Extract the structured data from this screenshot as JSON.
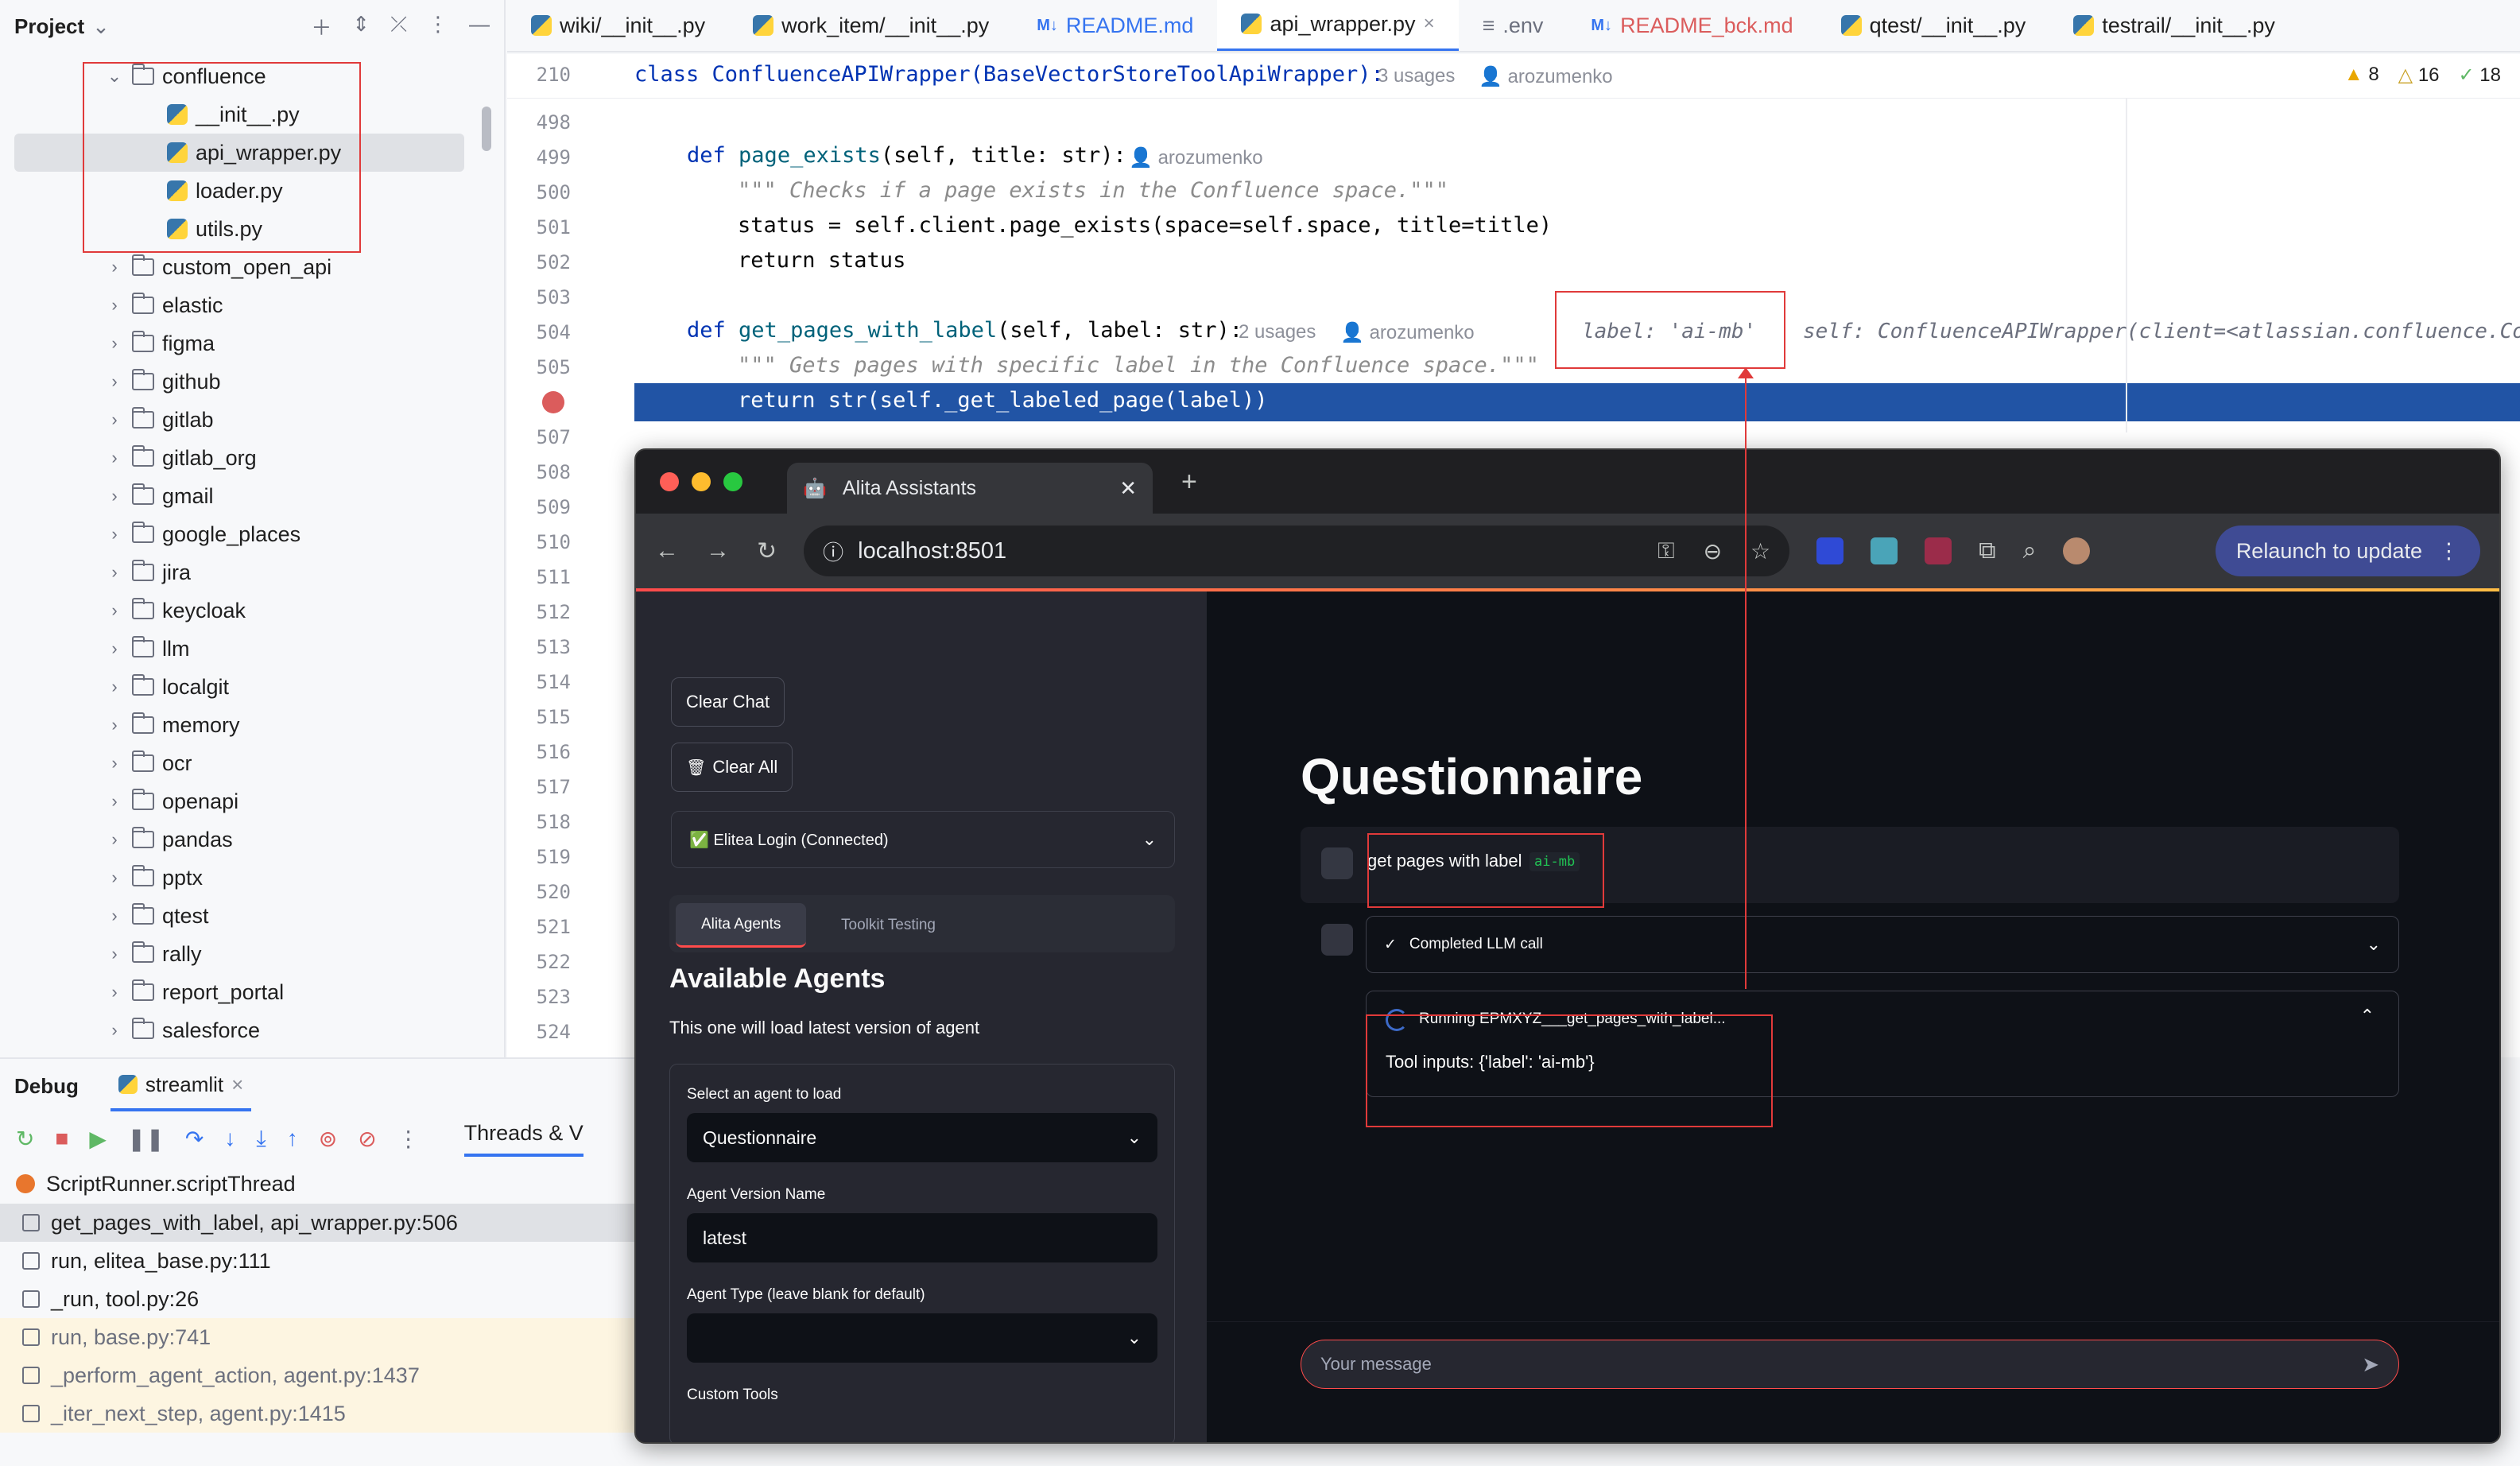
{
  "project": {
    "title": "Project",
    "items": [
      {
        "label": "confluence",
        "kind": "folder",
        "expanded": true
      },
      {
        "label": "__init__.py",
        "kind": "py"
      },
      {
        "label": "api_wrapper.py",
        "kind": "py",
        "selected": true
      },
      {
        "label": "loader.py",
        "kind": "py"
      },
      {
        "label": "utils.py",
        "kind": "py"
      },
      {
        "label": "custom_open_api",
        "kind": "folder"
      },
      {
        "label": "elastic",
        "kind": "folder"
      },
      {
        "label": "figma",
        "kind": "folder"
      },
      {
        "label": "github",
        "kind": "folder"
      },
      {
        "label": "gitlab",
        "kind": "folder"
      },
      {
        "label": "gitlab_org",
        "kind": "folder"
      },
      {
        "label": "gmail",
        "kind": "folder"
      },
      {
        "label": "google_places",
        "kind": "folder"
      },
      {
        "label": "jira",
        "kind": "folder"
      },
      {
        "label": "keycloak",
        "kind": "folder"
      },
      {
        "label": "llm",
        "kind": "folder"
      },
      {
        "label": "localgit",
        "kind": "folder"
      },
      {
        "label": "memory",
        "kind": "folder"
      },
      {
        "label": "ocr",
        "kind": "folder"
      },
      {
        "label": "openapi",
        "kind": "folder"
      },
      {
        "label": "pandas",
        "kind": "folder"
      },
      {
        "label": "pptx",
        "kind": "folder"
      },
      {
        "label": "qtest",
        "kind": "folder"
      },
      {
        "label": "rally",
        "kind": "folder"
      },
      {
        "label": "report_portal",
        "kind": "folder"
      },
      {
        "label": "salesforce",
        "kind": "folder"
      }
    ]
  },
  "editor_tabs": [
    {
      "label": "wiki/__init__.py",
      "icon": "python-icon"
    },
    {
      "label": "work_item/__init__.py",
      "icon": "python-icon"
    },
    {
      "label": "README.md",
      "icon": "markdown-icon",
      "badge": "M↓",
      "color": "#3574f0"
    },
    {
      "label": "api_wrapper.py",
      "icon": "python-icon",
      "active": true,
      "close": "×"
    },
    {
      "label": ".env",
      "icon": "text-icon",
      "color": "#6c707e"
    },
    {
      "label": "README_bck.md",
      "icon": "markdown-icon",
      "badge": "M↓",
      "color": "#db5c5c"
    },
    {
      "label": "qtest/__init__.py",
      "icon": "python-icon"
    },
    {
      "label": "testrail/__init__.py",
      "icon": "python-icon"
    }
  ],
  "editor": {
    "sticky": {
      "line": "210",
      "code": "class ConfluenceAPIWrapper(BaseVectorStoreToolApiWrapper):",
      "usages": "3 usages",
      "author": "arozumenko"
    },
    "inspections": {
      "warnings": "8",
      "weak_warnings": "16",
      "checks": "18"
    },
    "line_numbers": [
      "498",
      "499",
      "500",
      "501",
      "502",
      "503",
      "504",
      "505",
      "",
      "507",
      "508",
      "509",
      "510",
      "511",
      "512",
      "513",
      "514",
      "515",
      "516",
      "517",
      "518",
      "519",
      "520",
      "521",
      "522",
      "523",
      "524"
    ],
    "def1": {
      "kw": "def",
      "name": "page_exists",
      "params": "(self, title: str):",
      "author": "arozumenko"
    },
    "doc1": "\"\"\" Checks if a page exists in the Confluence space.\"\"\"",
    "stmt1": "status = self.client.page_exists(space=self.space, title=title)",
    "ret1": "return status",
    "def2": {
      "kw": "def",
      "name": "get_pages_with_label",
      "params": "(self, label: str):",
      "usages": "2 usages",
      "author": "arozumenko"
    },
    "inline_label": "label: 'ai-mb'",
    "inline_self": "self: ConfluenceAPIWrapper(client=<atlassian.confluence.Co",
    "doc2": "\"\"\" Gets pages with specific label in the Confluence space.\"\"\"",
    "current": "return str(self._get_labeled_page(label))"
  },
  "debug": {
    "title": "Debug",
    "session_tab": "streamlit",
    "threads_tab": "Threads & V",
    "thread": "ScriptRunner.scriptThread",
    "frames": [
      {
        "label": "get_pages_with_label, api_wrapper.py:506",
        "selected": true
      },
      {
        "label": "run, elitea_base.py:111"
      },
      {
        "label": "_run, tool.py:26"
      },
      {
        "label": "run, base.py:741",
        "library": true
      },
      {
        "label": "_perform_agent_action, agent.py:1437",
        "library": true
      },
      {
        "label": "_iter_next_step, agent.py:1415",
        "library": true
      }
    ]
  },
  "browser": {
    "tab_title": "Alita Assistants",
    "url": "localhost:8501",
    "relaunch": "Relaunch to update"
  },
  "app": {
    "sidebar": {
      "clear_chat": "Clear Chat",
      "clear_all": "Clear All",
      "login": "✅ Elitea Login (Connected)",
      "tabs": [
        "Alita Agents",
        "Toolkit Testing"
      ],
      "heading": "Available Agents",
      "subtext": "This one will load latest version of agent",
      "select_label": "Select an agent to load",
      "selected_agent": "Questionnaire",
      "version_label": "Agent Version Name",
      "version_value": "latest",
      "type_label": "Agent Type (leave blank for default)",
      "tools_label": "Custom Tools"
    },
    "main": {
      "title": "Questionnaire",
      "user_msg": "get pages with label",
      "user_code": "ai-mb",
      "status_done": "Completed LLM call",
      "status_running": "Running EPMXYZ___get_pages_with_label...",
      "tool_inputs": "Tool inputs: {'label': 'ai-mb'}",
      "input_placeholder": "Your message"
    }
  },
  "colors": {
    "accent": "#3574f0",
    "annotation": "#e03a3a",
    "streamlit_red": "#ff4b4b",
    "current_line": "#2154a5"
  }
}
